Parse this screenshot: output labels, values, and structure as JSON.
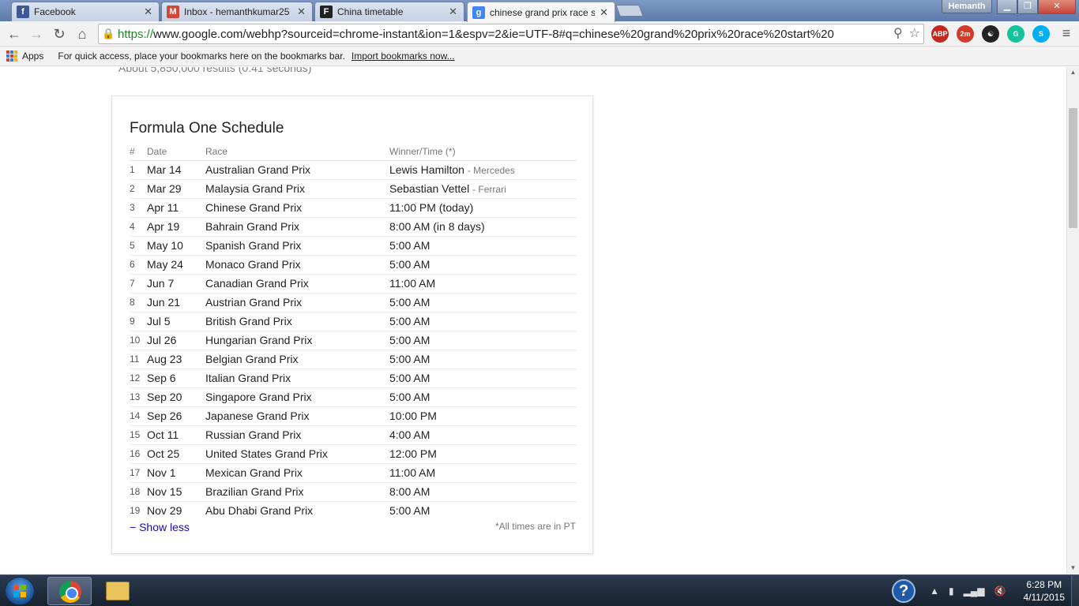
{
  "browser": {
    "tabs": [
      {
        "title": "Facebook",
        "icon": "facebook-icon",
        "color": "#3b5998",
        "glyph": "f",
        "active": false
      },
      {
        "title": "Inbox - hemanthkumar25",
        "icon": "gmail-icon",
        "color": "#d44638",
        "glyph": "M",
        "active": false
      },
      {
        "title": "China timetable",
        "icon": "f1-icon",
        "color": "#222222",
        "glyph": "F",
        "active": false
      },
      {
        "title": "chinese grand prix race st",
        "icon": "google-icon",
        "color": "#4285f4",
        "glyph": "g",
        "active": true
      }
    ],
    "profile_name": "Hemanth",
    "url_scheme": "https://",
    "url_rest": "www.google.com/webhp?sourceid=chrome-instant&ion=1&espv=2&ie=UTF-8#q=chinese%20grand%20prix%20race%20start%20",
    "extensions": [
      {
        "name": "abp-icon",
        "label": "ABP",
        "color": "#c4271d"
      },
      {
        "name": "2m-icon",
        "label": "2m",
        "color": "#d13b2a"
      },
      {
        "name": "yin-yang-icon",
        "label": "☯",
        "color": "#222222"
      },
      {
        "name": "grammarly-icon",
        "label": "G",
        "color": "#15c39a"
      },
      {
        "name": "skype-icon",
        "label": "S",
        "color": "#00aff0"
      }
    ]
  },
  "bookmarks": {
    "apps_label": "Apps",
    "hint_text": "For quick access, place your bookmarks here on the bookmarks bar.",
    "import_link": "Import bookmarks now..."
  },
  "search": {
    "results_count": "About 5,850,000 results (0.41 seconds)"
  },
  "schedule": {
    "title": "Formula One Schedule",
    "columns": [
      "#",
      "Date",
      "Race",
      "Winner/Time (*)"
    ],
    "rows": [
      {
        "num": "1",
        "date": "Mar 14",
        "race": "Australian Grand Prix",
        "result": "Lewis Hamilton",
        "team": "- Mercedes"
      },
      {
        "num": "2",
        "date": "Mar 29",
        "race": "Malaysia Grand Prix",
        "result": "Sebastian Vettel",
        "team": "- Ferrari"
      },
      {
        "num": "3",
        "date": "Apr 11",
        "race": "Chinese Grand Prix",
        "result": "11:00 PM (today)",
        "team": ""
      },
      {
        "num": "4",
        "date": "Apr 19",
        "race": "Bahrain Grand Prix",
        "result": "8:00 AM (in 8 days)",
        "team": ""
      },
      {
        "num": "5",
        "date": "May 10",
        "race": "Spanish Grand Prix",
        "result": "5:00 AM",
        "team": ""
      },
      {
        "num": "6",
        "date": "May 24",
        "race": "Monaco Grand Prix",
        "result": "5:00 AM",
        "team": ""
      },
      {
        "num": "7",
        "date": "Jun 7",
        "race": "Canadian Grand Prix",
        "result": "11:00 AM",
        "team": ""
      },
      {
        "num": "8",
        "date": "Jun 21",
        "race": "Austrian Grand Prix",
        "result": "5:00 AM",
        "team": ""
      },
      {
        "num": "9",
        "date": "Jul 5",
        "race": "British Grand Prix",
        "result": "5:00 AM",
        "team": ""
      },
      {
        "num": "10",
        "date": "Jul 26",
        "race": "Hungarian Grand Prix",
        "result": "5:00 AM",
        "team": ""
      },
      {
        "num": "11",
        "date": "Aug 23",
        "race": "Belgian Grand Prix",
        "result": "5:00 AM",
        "team": ""
      },
      {
        "num": "12",
        "date": "Sep 6",
        "race": "Italian Grand Prix",
        "result": "5:00 AM",
        "team": ""
      },
      {
        "num": "13",
        "date": "Sep 20",
        "race": "Singapore Grand Prix",
        "result": "5:00 AM",
        "team": ""
      },
      {
        "num": "14",
        "date": "Sep 26",
        "race": "Japanese Grand Prix",
        "result": "10:00 PM",
        "team": ""
      },
      {
        "num": "15",
        "date": "Oct 11",
        "race": "Russian Grand Prix",
        "result": "4:00 AM",
        "team": ""
      },
      {
        "num": "16",
        "date": "Oct 25",
        "race": "United States Grand Prix",
        "result": "12:00 PM",
        "team": ""
      },
      {
        "num": "17",
        "date": "Nov 1",
        "race": "Mexican Grand Prix",
        "result": "11:00 AM",
        "team": ""
      },
      {
        "num": "18",
        "date": "Nov 15",
        "race": "Brazilian Grand Prix",
        "result": "8:00 AM",
        "team": ""
      },
      {
        "num": "19",
        "date": "Nov 29",
        "race": "Abu Dhabi Grand Prix",
        "result": "5:00 AM",
        "team": ""
      }
    ],
    "show_less": "− Show less",
    "footnote": "*All times are in PT"
  },
  "taskbar": {
    "time": "6:28 PM",
    "date": "4/11/2015"
  }
}
